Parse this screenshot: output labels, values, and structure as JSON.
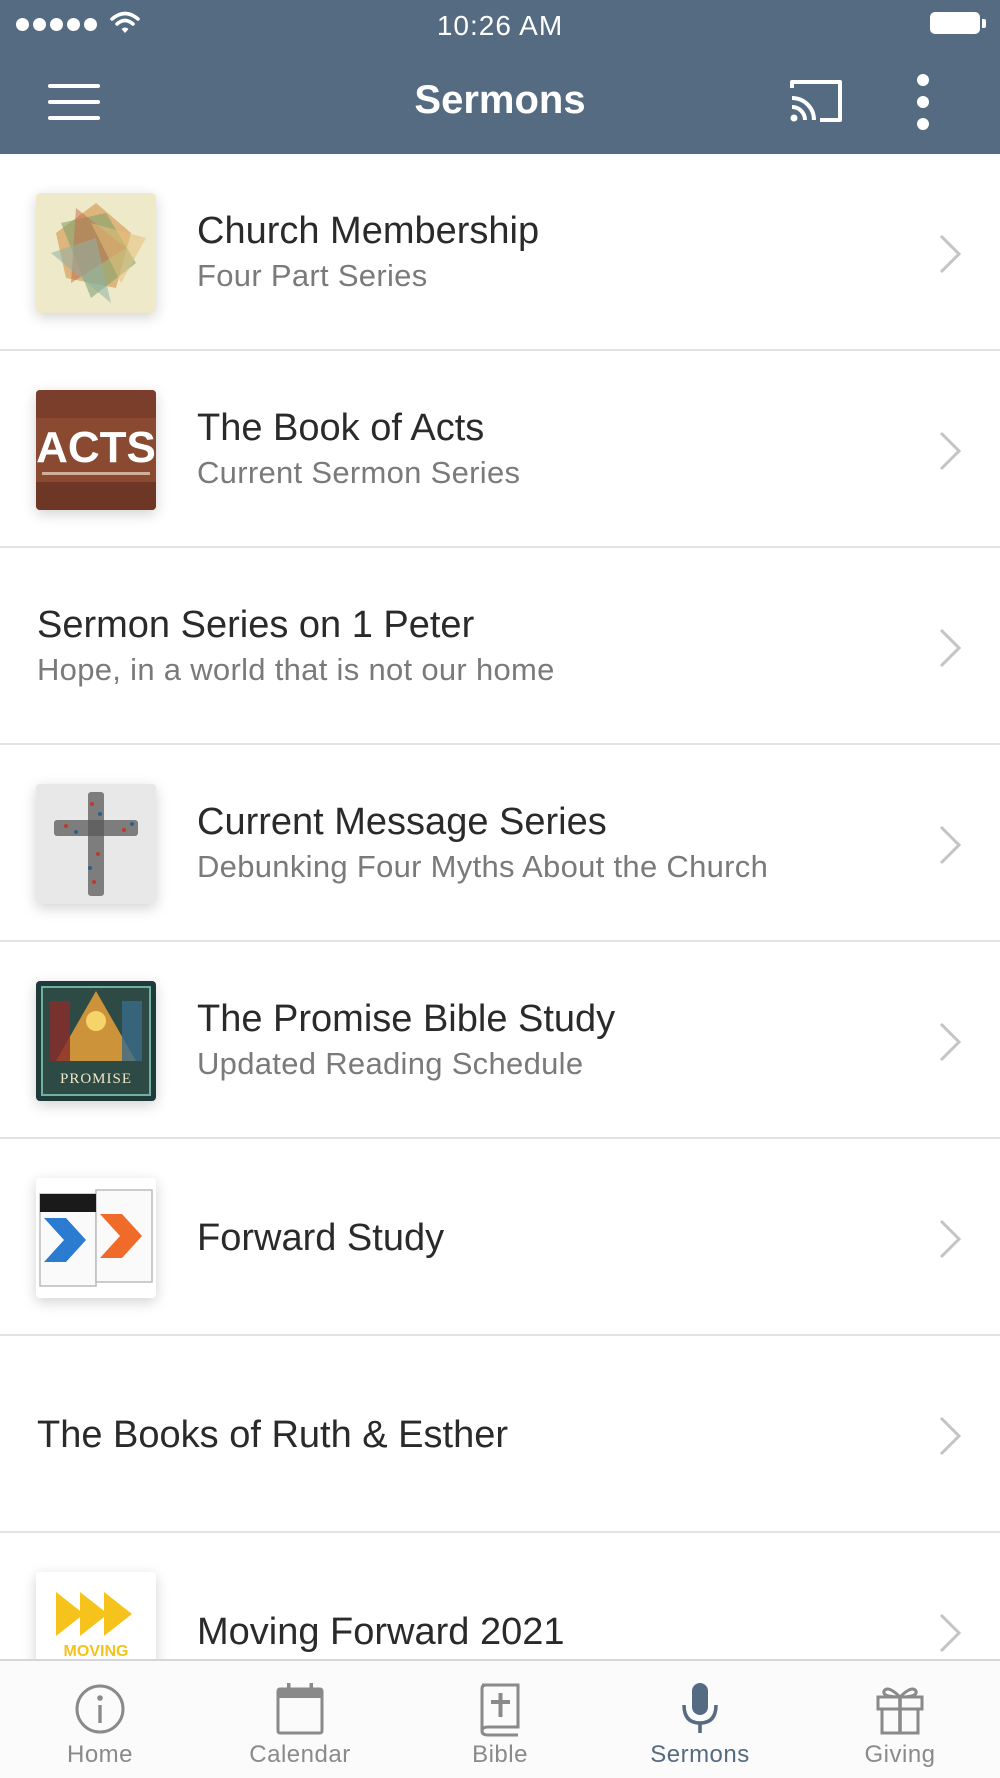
{
  "status_bar": {
    "time": "10:26 AM"
  },
  "header": {
    "title": "Sermons",
    "menu_icon": "menu-icon",
    "cast_icon": "cast-icon",
    "more_icon": "more-vertical-icon"
  },
  "colors": {
    "header_bg": "#556b82",
    "active_tab": "#556b82",
    "inactive_tab": "#8a8a8a",
    "divider": "#e3e3e3"
  },
  "sermons": [
    {
      "title": "Church Membership",
      "subtitle": "Four Part Series"
    },
    {
      "title": "The Book of Acts",
      "subtitle": "Current Sermon Series",
      "thumb_text": "ACTS"
    },
    {
      "title": "Sermon Series on 1 Peter",
      "subtitle": "Hope, in a world that is not our home"
    },
    {
      "title": "Current Message Series",
      "subtitle": "Debunking Four Myths About the Church"
    },
    {
      "title": "The Promise Bible Study",
      "subtitle": "Updated Reading Schedule",
      "thumb_text": "PROMISE"
    },
    {
      "title": "Forward Study",
      "subtitle": ""
    },
    {
      "title": "The Books of Ruth & Esther",
      "subtitle": ""
    },
    {
      "title": "Moving Forward 2021",
      "subtitle": "",
      "thumb_text": "MOVING"
    }
  ],
  "tabs": [
    {
      "label": "Home",
      "icon": "info-icon"
    },
    {
      "label": "Calendar",
      "icon": "calendar-icon"
    },
    {
      "label": "Bible",
      "icon": "bible-icon"
    },
    {
      "label": "Sermons",
      "icon": "microphone-icon",
      "active": true
    },
    {
      "label": "Giving",
      "icon": "gift-icon"
    }
  ]
}
